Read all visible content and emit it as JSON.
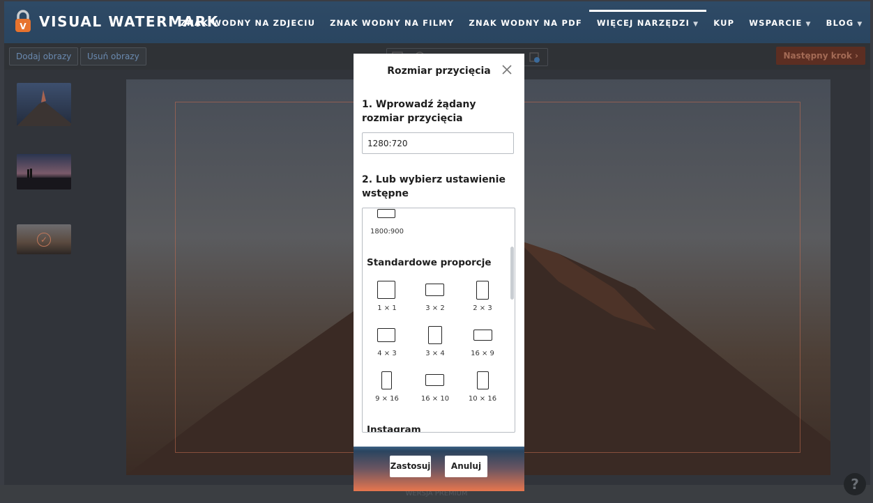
{
  "app": {
    "logo_text": "VISUAL WATERMARK"
  },
  "nav": {
    "items": [
      {
        "label": "ZNAK WODNY NA ZDJECIU",
        "dropdown": false,
        "active": false
      },
      {
        "label": "ZNAK WODNY NA FILMY",
        "dropdown": false,
        "active": false
      },
      {
        "label": "ZNAK WODNY NA PDF",
        "dropdown": false,
        "active": false
      },
      {
        "label": "WIĘCEJ NARZĘDZI",
        "dropdown": true,
        "active": true
      },
      {
        "label": "KUP",
        "dropdown": false,
        "active": false
      },
      {
        "label": "WSPARCIE",
        "dropdown": true,
        "active": false
      },
      {
        "label": "BLOG",
        "dropdown": true,
        "active": false
      }
    ],
    "caret": "▼"
  },
  "toolbar": {
    "add_images": "Dodaj obrazy",
    "remove_images": "Usuń obrazy",
    "next_step": "Następny krok"
  },
  "modal": {
    "title": "Rozmiar przycięcia",
    "step1_label": "1. Wprowadź żądany rozmiar przycięcia",
    "size_value": "1280:720",
    "step2_label": "2. Lub wybierz ustawienie wstępne",
    "partial_preset": "1800:900",
    "standard_title": "Standardowe proporcje",
    "presets": [
      {
        "label": "1 × 1"
      },
      {
        "label": "3 × 2"
      },
      {
        "label": "2 × 3"
      },
      {
        "label": "4 × 3"
      },
      {
        "label": "3 × 4"
      },
      {
        "label": "16 × 9"
      },
      {
        "label": "9 × 16"
      },
      {
        "label": "16 × 10"
      },
      {
        "label": "10 × 16"
      }
    ],
    "instagram_title": "Instagram",
    "apply": "Zastosuj",
    "cancel": "Anuluj"
  },
  "status": {
    "text": "WERSJA PREMIUM"
  },
  "help": {
    "label": "?"
  },
  "colors": {
    "header": "#2e4a66",
    "accent_orange": "#e7764e"
  }
}
